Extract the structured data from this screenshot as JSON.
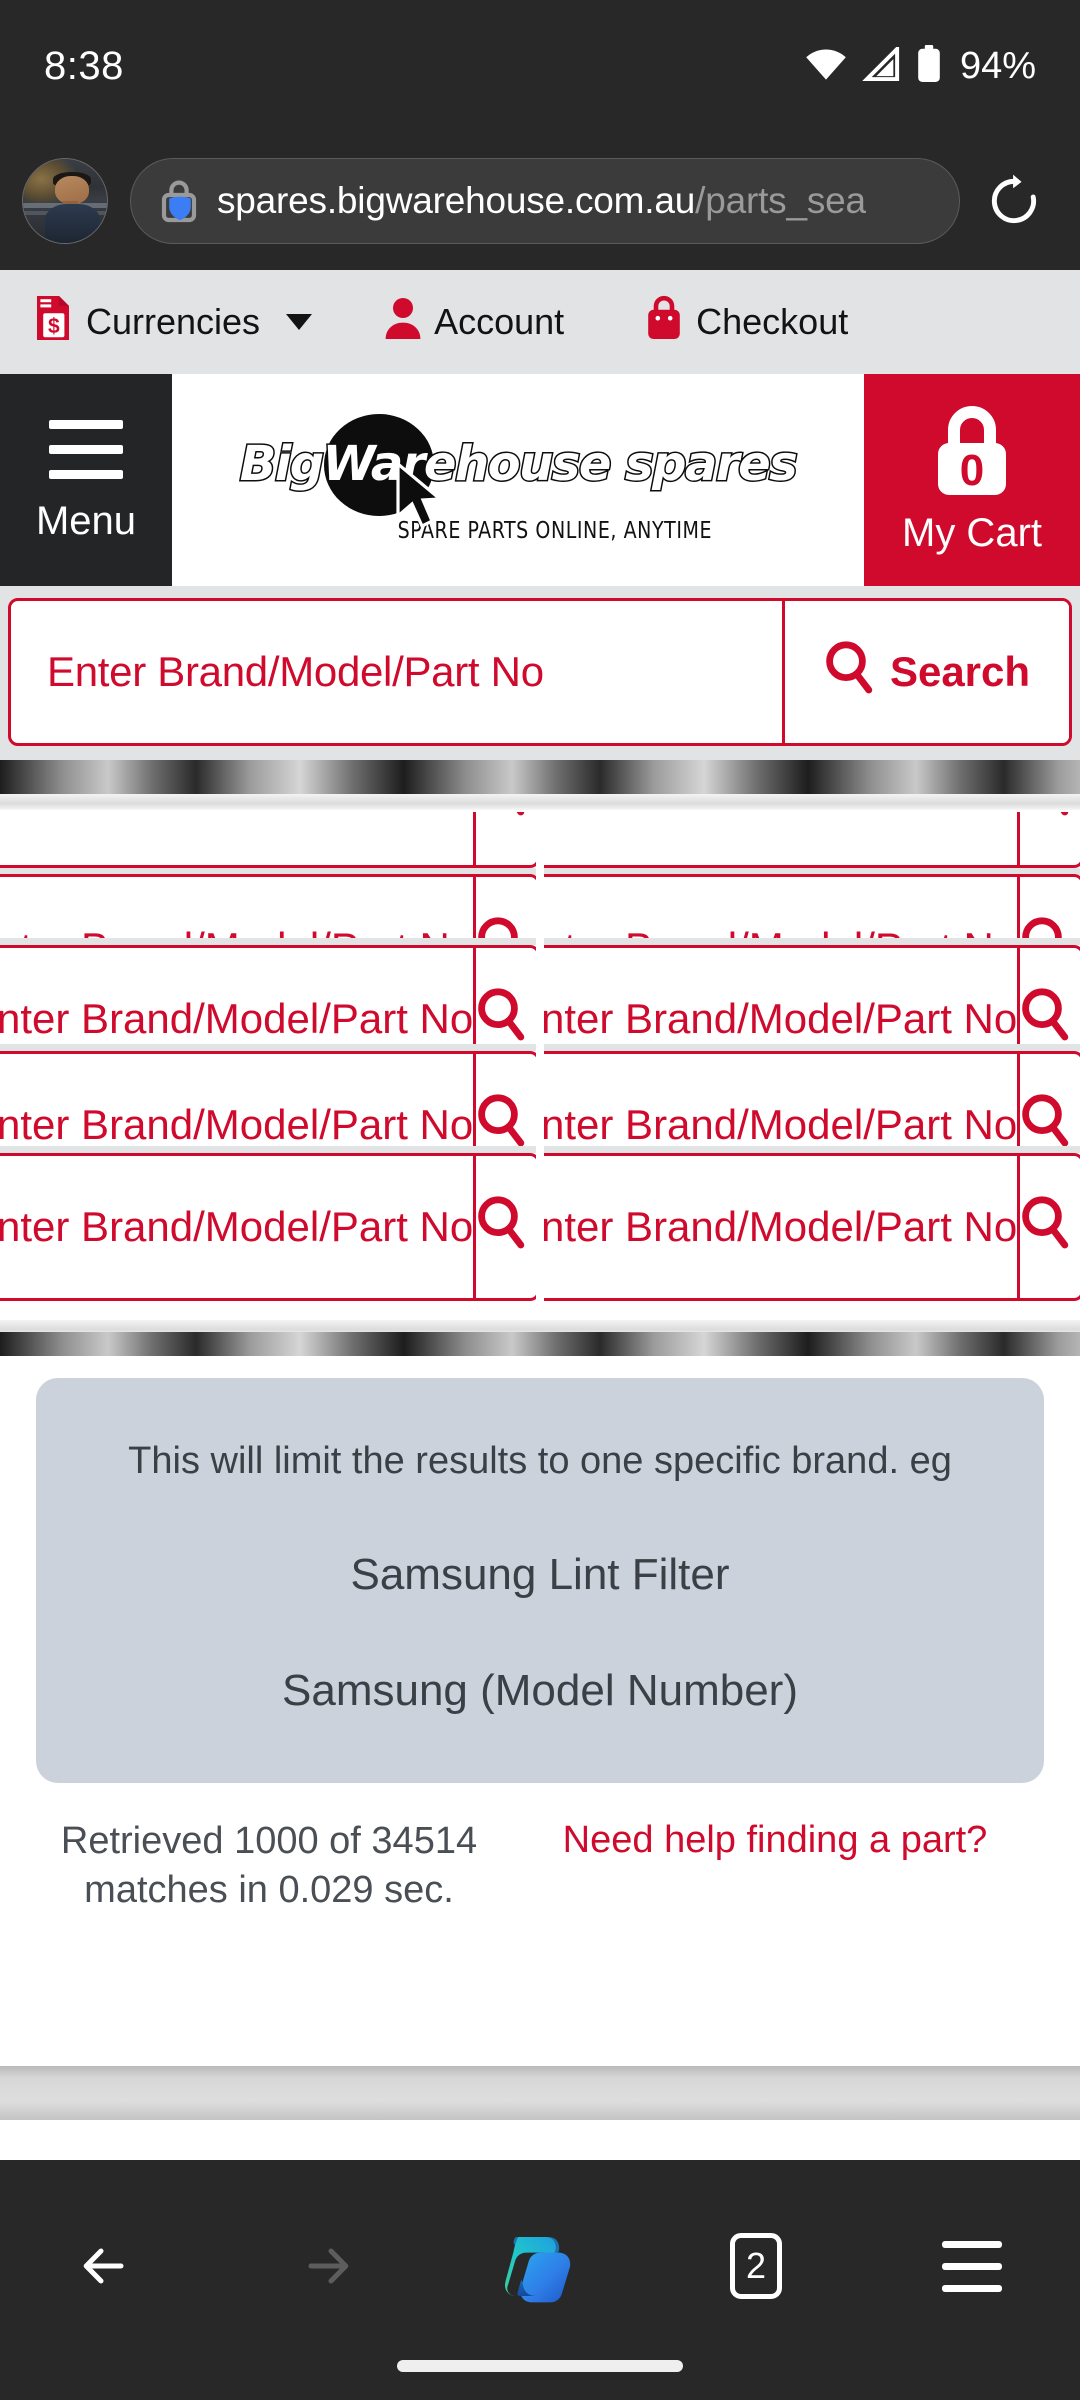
{
  "status_bar": {
    "time": "8:38",
    "battery_percent": "94%",
    "icons": [
      "wifi-icon",
      "cellular-signal-icon",
      "battery-icon"
    ]
  },
  "browser": {
    "avatar": "profile-avatar",
    "url_domain": "spares.bigwarehouse.com.au",
    "url_path": "/parts_sea",
    "lock_icon": "lock-icon",
    "shield_icon": "shield-icon",
    "reload_icon": "reload-icon",
    "bottom_nav": {
      "back_label": "back-arrow-icon",
      "forward_label": "forward-arrow-icon",
      "copilot_label": "copilot-icon",
      "tab_count": "2",
      "menu_label": "menu-icon"
    }
  },
  "site": {
    "utility_nav": [
      {
        "label": "Currencies",
        "icon": "currency-document-icon",
        "has_caret": true
      },
      {
        "label": "Account",
        "icon": "person-icon",
        "has_caret": false
      },
      {
        "label": "Checkout",
        "icon": "shopping-bag-icon",
        "has_caret": false
      }
    ],
    "menu_label": "Menu",
    "logo_text": "BigWarehouse spares",
    "logo_tagline": "SPARE PARTS ONLINE, ANYTIME",
    "cart": {
      "label": "My Cart",
      "count": "0"
    },
    "search": {
      "placeholder": "Enter Brand/Model/Part No",
      "button_label": "Search",
      "search_icon": "magnifier-icon"
    },
    "info_box": {
      "line1": "This will limit the results to one specific brand. eg",
      "line2": "Samsung Lint Filter",
      "line3": "Samsung (Model Number)"
    },
    "results": {
      "retrieved_line1": "Retrieved 1000 of 34514",
      "retrieved_line2": "matches in 0.029 sec.",
      "help_link": "Need help finding a part?"
    }
  },
  "colors": {
    "brand_red": "#cf0a2c",
    "chrome_dark": "#282828",
    "utility_gray": "#e2e3e5",
    "info_panel": "#ccd2dc",
    "menu_dark": "#242526"
  }
}
